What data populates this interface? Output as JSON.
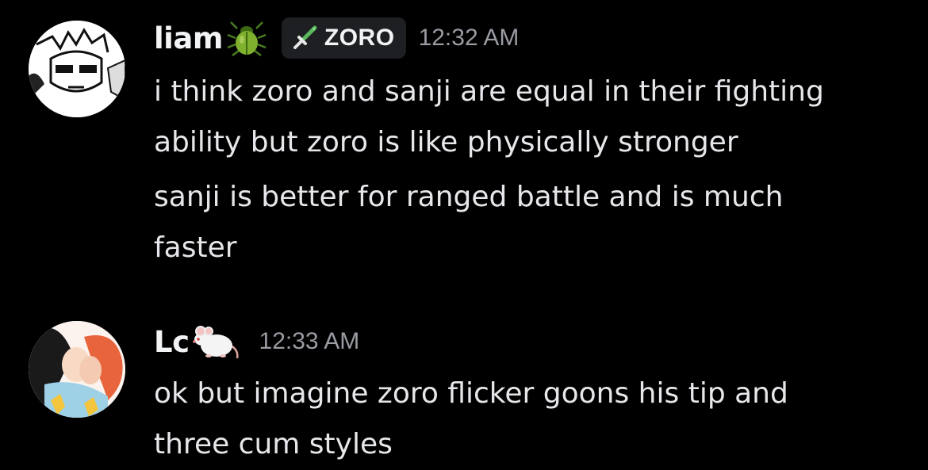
{
  "messages": [
    {
      "username": "liam",
      "name_icon": "beetle-icon",
      "role_tag": {
        "icon": "sword-icon",
        "label": "ZORO"
      },
      "timestamp": "12:32 AM",
      "avatar": "manga-avatar-zoro",
      "lines": [
        "i think zoro and sanji are equal in their fighting",
        "ability but zoro is like physically stronger",
        "sanji is better for ranged battle and is much",
        "faster"
      ]
    },
    {
      "username": "Lc",
      "name_icon": "rat-icon",
      "timestamp": "12:33 AM",
      "avatar": "illustrated-avatar-couple",
      "lines": [
        "ok but imagine zoro flicker goons his tip and",
        "three cum styles"
      ]
    }
  ],
  "colors": {
    "background": "#000000",
    "username": "#f2f3f5",
    "message_text": "#e6e7ea",
    "timestamp": "#9a9ca3",
    "role_tag_bg": "#1e1f22",
    "sword_green": "#5cb85c"
  }
}
